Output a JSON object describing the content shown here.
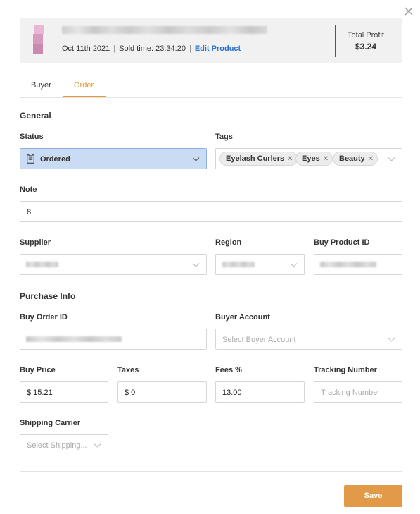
{
  "header": {
    "date": "Oct 11th 2021",
    "sold_time": "Sold time: 23:34:20",
    "edit_link": "Edit Product",
    "total_profit_label": "Total Profit",
    "total_profit_value": "$3.24"
  },
  "tabs": [
    {
      "label": "Buyer",
      "active": false
    },
    {
      "label": "Order",
      "active": true
    }
  ],
  "general": {
    "section_title": "General",
    "status_label": "Status",
    "status_value": "Ordered",
    "tags_label": "Tags",
    "tags": [
      "Eyelash Curlers",
      "Eyes",
      "Beauty"
    ],
    "note_label": "Note",
    "note_value": "8",
    "supplier_label": "Supplier",
    "region_label": "Region",
    "buy_product_id_label": "Buy Product ID"
  },
  "purchase": {
    "section_title": "Purchase Info",
    "buy_order_id_label": "Buy Order ID",
    "buyer_account_label": "Buyer Account",
    "buyer_account_placeholder": "Select Buyer Account",
    "buy_price_label": "Buy Price",
    "buy_price_value": "$ 15.21",
    "taxes_label": "Taxes",
    "taxes_value": "$ 0",
    "fees_label": "Fees %",
    "fees_value": "13.00",
    "tracking_label": "Tracking Number",
    "tracking_placeholder": "Tracking Number",
    "carrier_label": "Shipping Carrier",
    "carrier_placeholder": "Select Shipping..."
  },
  "footer": {
    "save_label": "Save"
  },
  "colors": {
    "accent": "#e39a3b",
    "link": "#2c73c9",
    "status_bg": "#c9dcf3",
    "save_bg": "#e39a48"
  },
  "icons": {
    "close": "close-icon",
    "chevron": "chevron-down-icon",
    "status": "clipboard-icon",
    "tag_remove": "remove-tag-icon"
  }
}
